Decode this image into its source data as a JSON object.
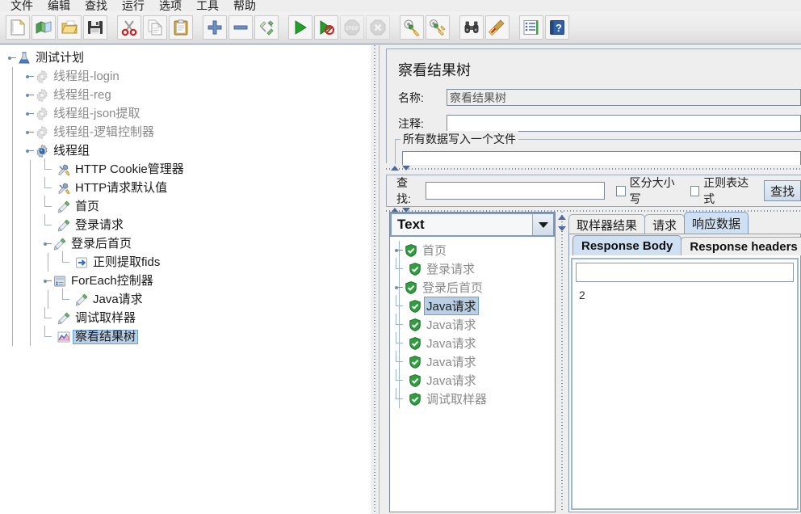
{
  "menu": {
    "items": [
      {
        "label": "文件"
      },
      {
        "label": "编辑"
      },
      {
        "label": "查找"
      },
      {
        "label": "运行"
      },
      {
        "label": "选项"
      },
      {
        "label": "工具"
      },
      {
        "label": "帮助"
      }
    ]
  },
  "toolbar": {
    "buttons": [
      {
        "name": "new-test-plan",
        "icon": "new-document-icon",
        "enabled": true
      },
      {
        "name": "open-templates",
        "icon": "templates-icon",
        "enabled": true
      },
      {
        "name": "open-file",
        "icon": "open-folder-icon",
        "enabled": true
      },
      {
        "name": "save-test-plan",
        "icon": "save-floppy-icon",
        "enabled": true
      },
      {
        "name": "cut",
        "icon": "scissors-icon",
        "enabled": true
      },
      {
        "name": "copy",
        "icon": "copy-pages-icon",
        "enabled": true
      },
      {
        "name": "paste",
        "icon": "clipboard-icon",
        "enabled": true
      },
      {
        "name": "expand-all",
        "icon": "plus-icon",
        "enabled": true
      },
      {
        "name": "collapse-all",
        "icon": "minus-icon",
        "enabled": true
      },
      {
        "name": "toggle-enabled",
        "icon": "toggle-pins-icon",
        "enabled": true
      },
      {
        "name": "start-test",
        "icon": "play-green-icon",
        "enabled": true
      },
      {
        "name": "start-no-timers",
        "icon": "play-no-timers-icon",
        "enabled": true
      },
      {
        "name": "stop-test",
        "icon": "stop-sign-icon",
        "enabled": false
      },
      {
        "name": "shutdown-test",
        "icon": "shutdown-x-icon",
        "enabled": false
      },
      {
        "name": "clear",
        "icon": "clear-broom-icon",
        "enabled": true
      },
      {
        "name": "clear-all",
        "icon": "clear-all-broom-icon",
        "enabled": true
      },
      {
        "name": "search",
        "icon": "binoculars-icon",
        "enabled": true
      },
      {
        "name": "search-reset",
        "icon": "broom-reset-icon",
        "enabled": true
      },
      {
        "name": "function-helper",
        "icon": "function-list-icon",
        "enabled": true
      },
      {
        "name": "help",
        "icon": "help-book-icon",
        "enabled": true
      }
    ]
  },
  "tree": {
    "nodes": [
      {
        "label": "测试计划",
        "depth": 0,
        "icon": "test-plan-icon",
        "expanded": true,
        "toggle": true,
        "enabled": true,
        "selected": false
      },
      {
        "label": "线程组-login",
        "depth": 1,
        "icon": "thread-group-icon",
        "expanded": false,
        "toggle": true,
        "enabled": false,
        "selected": false
      },
      {
        "label": "线程组-reg",
        "depth": 1,
        "icon": "thread-group-icon",
        "expanded": false,
        "toggle": true,
        "enabled": false,
        "selected": false
      },
      {
        "label": "线程组-json提取",
        "depth": 1,
        "icon": "thread-group-icon",
        "expanded": false,
        "toggle": true,
        "enabled": false,
        "selected": false
      },
      {
        "label": "线程组-逻辑控制器",
        "depth": 1,
        "icon": "thread-group-icon",
        "expanded": false,
        "toggle": true,
        "enabled": false,
        "selected": false
      },
      {
        "label": "线程组",
        "depth": 1,
        "icon": "thread-group-active-icon",
        "expanded": true,
        "toggle": true,
        "enabled": true,
        "selected": false
      },
      {
        "label": "HTTP Cookie管理器",
        "depth": 2,
        "icon": "config-tools-icon",
        "expanded": false,
        "toggle": false,
        "enabled": true,
        "selected": false
      },
      {
        "label": "HTTP请求默认值",
        "depth": 2,
        "icon": "config-tools-icon",
        "expanded": false,
        "toggle": false,
        "enabled": true,
        "selected": false
      },
      {
        "label": "首页",
        "depth": 2,
        "icon": "sampler-icon",
        "expanded": false,
        "toggle": false,
        "enabled": true,
        "selected": false
      },
      {
        "label": "登录请求",
        "depth": 2,
        "icon": "sampler-icon",
        "expanded": false,
        "toggle": false,
        "enabled": true,
        "selected": false
      },
      {
        "label": "登录后首页",
        "depth": 2,
        "icon": "sampler-icon",
        "expanded": true,
        "toggle": true,
        "enabled": true,
        "selected": false
      },
      {
        "label": "正则提取fids",
        "depth": 3,
        "icon": "post-processor-icon",
        "expanded": false,
        "toggle": false,
        "enabled": true,
        "selected": false
      },
      {
        "label": "ForEach控制器",
        "depth": 2,
        "icon": "controller-icon",
        "expanded": true,
        "toggle": true,
        "enabled": true,
        "selected": false
      },
      {
        "label": "Java请求",
        "depth": 3,
        "icon": "sampler-icon",
        "expanded": false,
        "toggle": false,
        "enabled": true,
        "selected": false
      },
      {
        "label": "调试取样器",
        "depth": 2,
        "icon": "sampler-icon",
        "expanded": false,
        "toggle": false,
        "enabled": true,
        "selected": false
      },
      {
        "label": "察看结果树",
        "depth": 2,
        "icon": "results-tree-icon",
        "expanded": false,
        "toggle": false,
        "enabled": true,
        "selected": true
      }
    ]
  },
  "panel": {
    "title": "察看结果树",
    "name_label": "名称:",
    "name_value": "察看结果树",
    "comment_label": "注释:",
    "comment_value": "",
    "filegroup_title": "所有数据写入一个文件",
    "filegroup_value": ""
  },
  "search": {
    "label": "查找:",
    "value": "",
    "placeholder": "",
    "case_sensitive_label": "区分大小写",
    "case_sensitive_checked": false,
    "regex_label": "正则表达式",
    "regex_checked": false,
    "find_button_label": "查找"
  },
  "results": {
    "render_combo_value": "Text",
    "nodes": [
      {
        "label": "首页",
        "icon": "success-shield-icon",
        "toggle": true,
        "selected": false
      },
      {
        "label": "登录请求",
        "icon": "success-shield-icon",
        "toggle": false,
        "selected": false
      },
      {
        "label": "登录后首页",
        "icon": "success-shield-icon",
        "toggle": true,
        "selected": false
      },
      {
        "label": "Java请求",
        "icon": "success-shield-icon",
        "toggle": false,
        "selected": true
      },
      {
        "label": "Java请求",
        "icon": "success-shield-icon",
        "toggle": false,
        "selected": false
      },
      {
        "label": "Java请求",
        "icon": "success-shield-icon",
        "toggle": false,
        "selected": false
      },
      {
        "label": "Java请求",
        "icon": "success-shield-icon",
        "toggle": false,
        "selected": false
      },
      {
        "label": "Java请求",
        "icon": "success-shield-icon",
        "toggle": false,
        "selected": false
      },
      {
        "label": "调试取样器",
        "icon": "success-shield-icon",
        "toggle": false,
        "selected": false
      }
    ]
  },
  "tabs": {
    "main": [
      {
        "label": "取样器结果",
        "active": false
      },
      {
        "label": "请求",
        "active": false
      },
      {
        "label": "响应数据",
        "active": true
      }
    ],
    "sub": [
      {
        "label": "Response Body",
        "active": true
      },
      {
        "label": "Response headers",
        "active": false
      }
    ]
  },
  "response": {
    "filter_value": "",
    "body_text": "2"
  },
  "colors": {
    "toolbar_bg": "#eaeaea",
    "panel_bg": "#eeeeee",
    "selection_bg": "#b8cfe5",
    "selection_border": "#6f9fcf",
    "tab_active_bg": "#cfe0f2",
    "border": "#9aa7b5",
    "text": "#1a1a1a",
    "text_muted": "#8a8a8a",
    "success_green": "#2f9e3f"
  }
}
